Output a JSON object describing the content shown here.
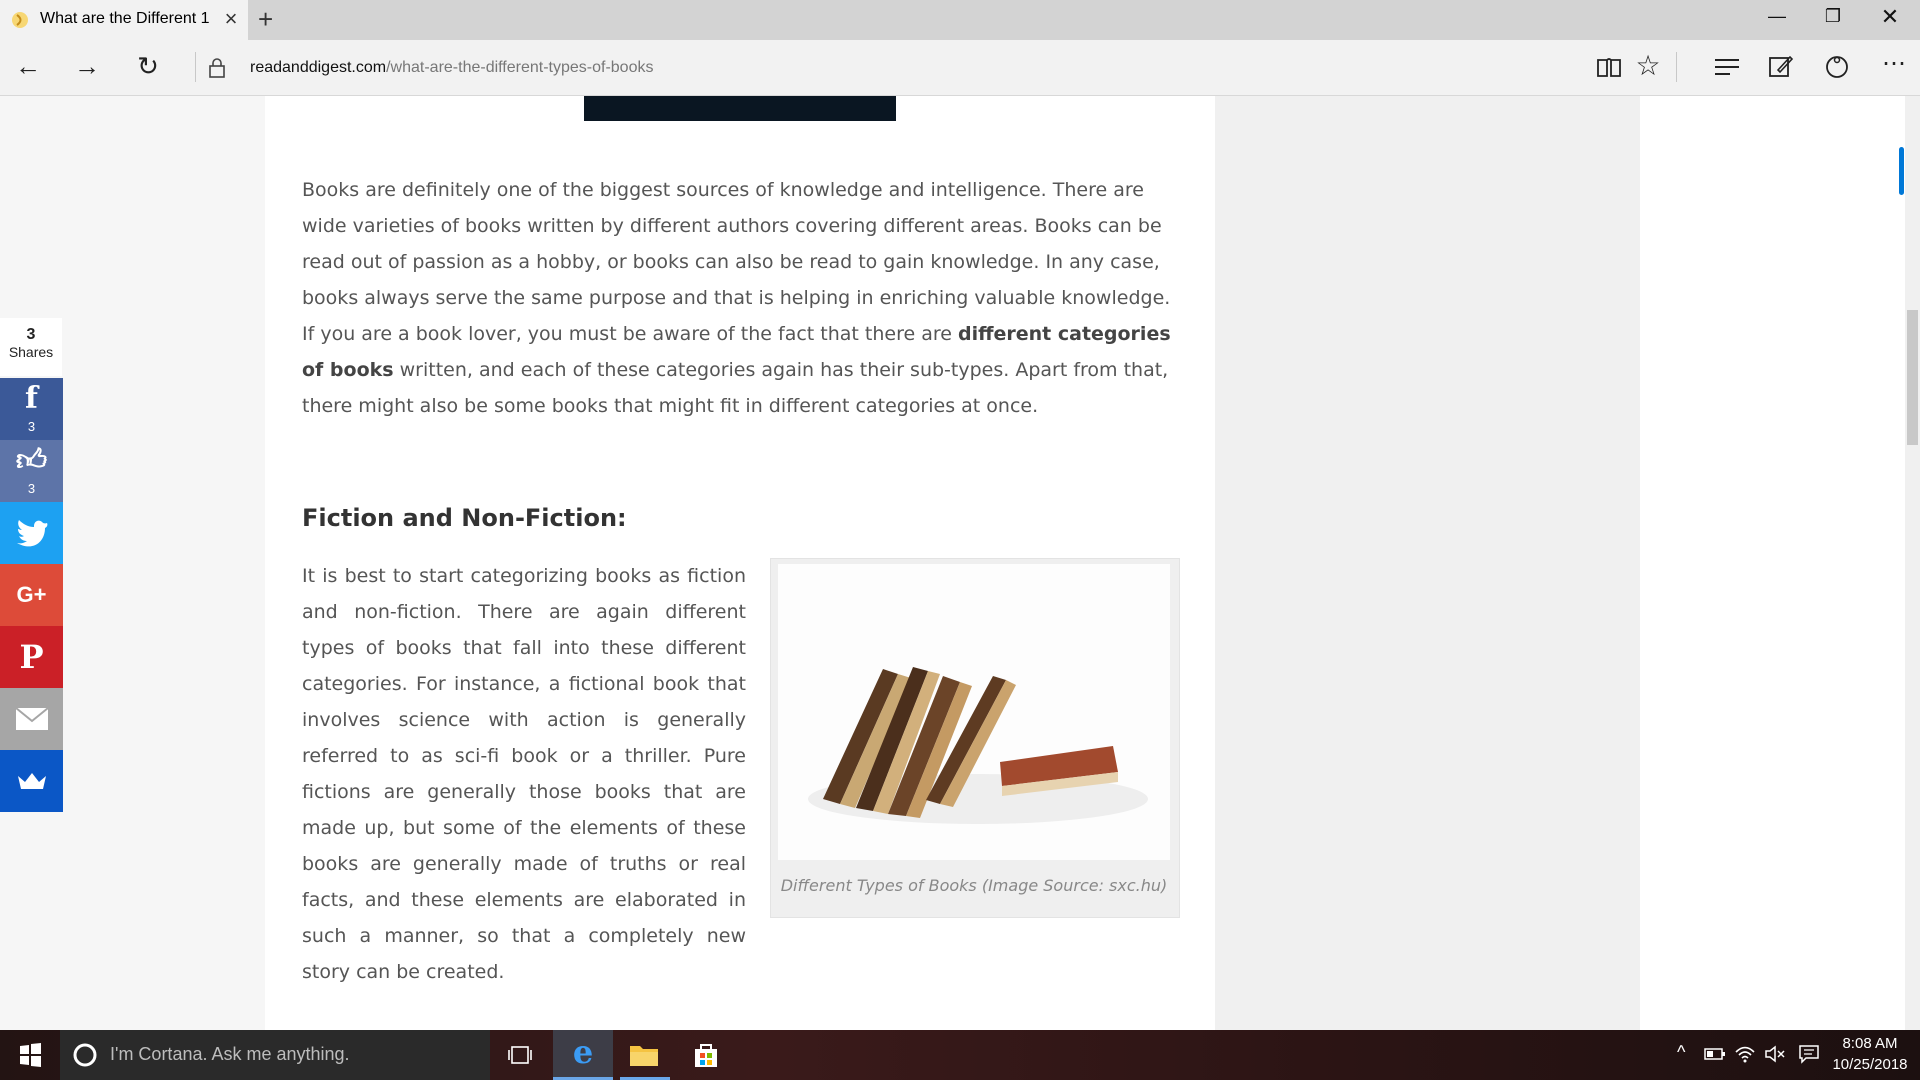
{
  "browser": {
    "tab_title": "What are the Different 1",
    "url_domain": "readanddigest.com",
    "url_path": "/what-are-the-different-types-of-books"
  },
  "article": {
    "paragraph1_part1": "Books are definitely one of the biggest sources of knowledge and intelligence. There are wide varieties of books written by different authors covering different areas. Books can be read out of passion as a hobby, or books can also be read to gain knowledge. In any case, books always serve the same purpose and that is helping in enriching valuable knowledge. If you are a book lover, you must be aware of the fact that there are ",
    "paragraph1_bold": "different categories of books",
    "paragraph1_part2": " written, and each of these categories again has their sub-types. Apart from that, there might also be some books that might fit in different categories at once.",
    "heading_fiction": "Fiction and Non-Fiction:",
    "paragraph2": "It is best to start categorizing books as fiction and non-fiction. There are again different types of books that fall into these different categories. For instance, a fictional book that involves science with action is generally referred to as sci-fi book or a thriller. Pure fictions are generally those books that are made up, but some of the elements of these books are generally made of truths or real facts, and these elements are elaborated in such a manner, so that a completely new story can be created.",
    "figure_caption": "Different Types of Books (Image Source: sxc.hu)"
  },
  "share": {
    "count": "3",
    "label": "Shares",
    "facebook_count": "3",
    "like_count": "3",
    "facebook_icon": "f",
    "googleplus_icon": "G+",
    "pinterest_icon": "P",
    "colors": {
      "facebook": "#3b5998",
      "like": "#5d74a8",
      "twitter": "#1da1f2",
      "googleplus": "#dd4b39",
      "pinterest": "#cb2027",
      "email": "#a6a6a6",
      "sumo": "#0b57c6"
    }
  },
  "taskbar": {
    "cortana_placeholder": "I'm Cortana. Ask me anything.",
    "time": "8:08 AM",
    "date": "10/25/2018"
  }
}
